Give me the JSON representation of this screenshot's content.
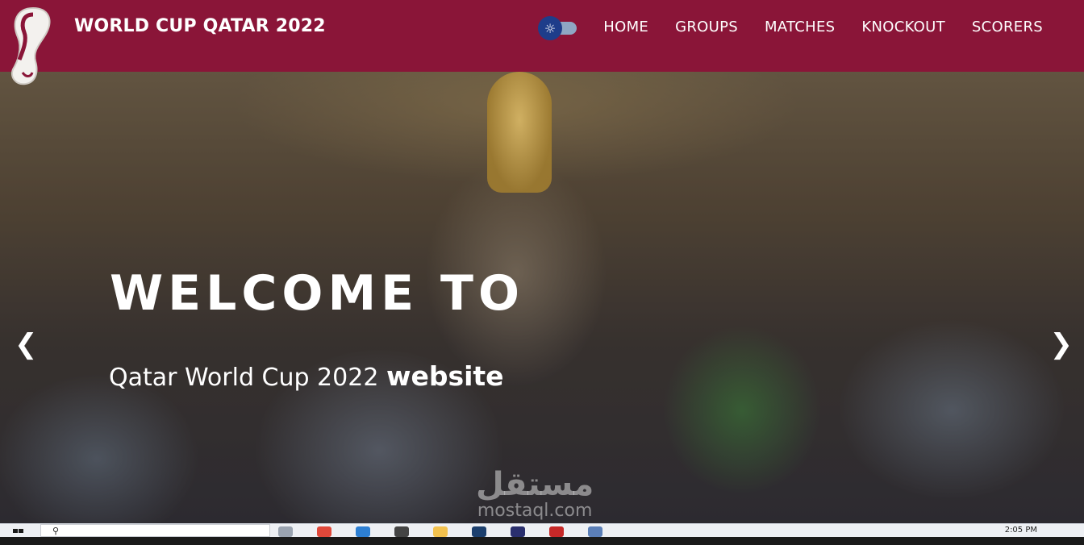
{
  "header": {
    "title": "WORLD CUP QATAR 2022",
    "brand_color": "#8a1538"
  },
  "nav": {
    "items": [
      {
        "label": "HOME"
      },
      {
        "label": "GROUPS"
      },
      {
        "label": "MATCHES"
      },
      {
        "label": "KNOCKOUT"
      },
      {
        "label": "SCORERS"
      }
    ]
  },
  "theme_toggle": {
    "icon": "sun-icon",
    "state": "light"
  },
  "hero": {
    "title": "WELCOME TO",
    "subtitle_lead": "Qatar World Cup 2022",
    "subtitle_emphasis": "website",
    "prev_glyph": "❮",
    "next_glyph": "❯"
  },
  "watermark": {
    "arabic": "مستقل",
    "latin": "mostaql.com"
  },
  "taskbar": {
    "clock": "2:05 PM"
  }
}
